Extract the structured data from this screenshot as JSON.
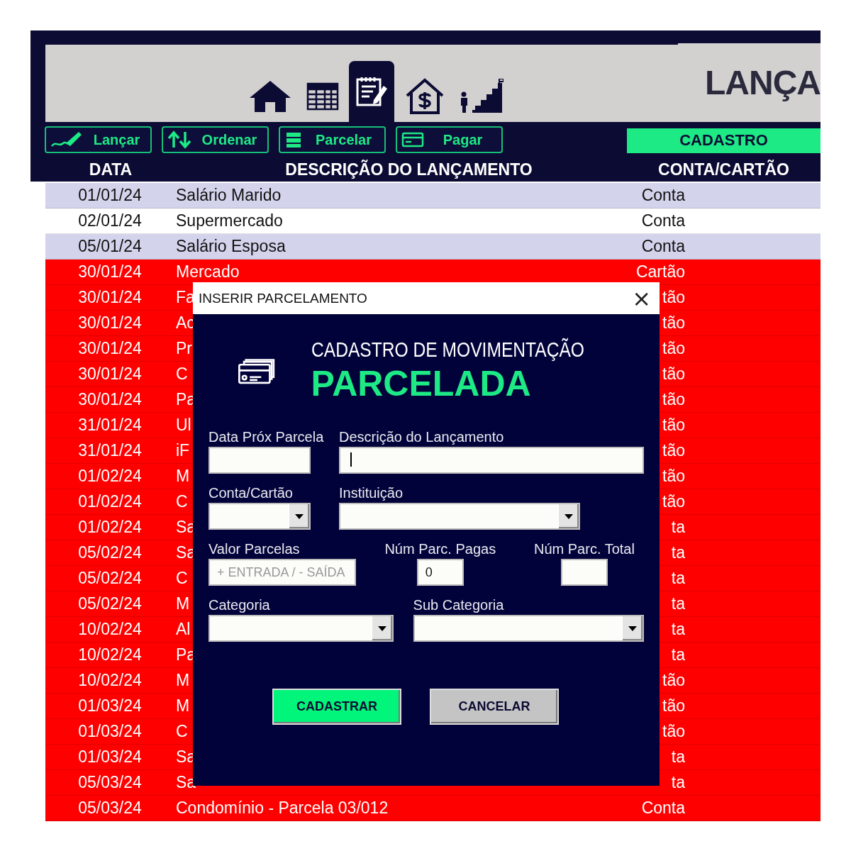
{
  "nav_tabs": [
    {
      "selected": false
    },
    {
      "selected": false
    },
    {
      "selected": true
    },
    {
      "selected": false
    },
    {
      "selected": false
    }
  ],
  "title": "LANÇA",
  "action_buttons": [
    "Lançar",
    "Ordenar",
    "Parcelar",
    "Pagar"
  ],
  "section_label": "CADASTRO",
  "table": {
    "columns": [
      "DATA",
      "DESCRIÇÃO DO LANÇAMENTO",
      "CONTA/CARTÃO"
    ],
    "rows": [
      {
        "date": "01/01/24",
        "description": "Salário Marido",
        "account": "Conta",
        "color": "#d3d3ec"
      },
      {
        "date": "02/01/24",
        "description": "Supermercado",
        "account": "Conta",
        "color": "#ffffff"
      },
      {
        "date": "05/01/24",
        "description": "Salário Esposa",
        "account": "Conta",
        "color": "#d3d3ec"
      },
      {
        "date": "30/01/24",
        "description": "Mercado",
        "account": "Cartão",
        "color": "#ff0000"
      },
      {
        "date": "30/01/24",
        "description": "Fa",
        "account": "tão",
        "color": "#ff0000"
      },
      {
        "date": "30/01/24",
        "description": "Ac",
        "account": "tão",
        "color": "#ff0000"
      },
      {
        "date": "30/01/24",
        "description": "Pr",
        "account": "tão",
        "color": "#ff0000"
      },
      {
        "date": "30/01/24",
        "description": "C",
        "account": "tão",
        "color": "#ff0000"
      },
      {
        "date": "30/01/24",
        "description": "Pa",
        "account": "tão",
        "color": "#ff0000"
      },
      {
        "date": "31/01/24",
        "description": "Ul",
        "account": "tão",
        "color": "#ff0000"
      },
      {
        "date": "31/01/24",
        "description": "iF",
        "account": "tão",
        "color": "#ff0000"
      },
      {
        "date": "01/02/24",
        "description": "M",
        "account": "tão",
        "color": "#ff0000"
      },
      {
        "date": "01/02/24",
        "description": "C",
        "account": "tão",
        "color": "#ff0000"
      },
      {
        "date": "01/02/24",
        "description": "Sa",
        "account": "ta",
        "color": "#ff0000"
      },
      {
        "date": "05/02/24",
        "description": "Sa",
        "account": "ta",
        "color": "#ff0000"
      },
      {
        "date": "05/02/24",
        "description": "C",
        "account": "ta",
        "color": "#ff0000"
      },
      {
        "date": "05/02/24",
        "description": "M",
        "account": "ta",
        "color": "#ff0000"
      },
      {
        "date": "10/02/24",
        "description": "Al",
        "account": "ta",
        "color": "#ff0000"
      },
      {
        "date": "10/02/24",
        "description": "Pa",
        "account": "ta",
        "color": "#ff0000"
      },
      {
        "date": "10/02/24",
        "description": "M",
        "account": "tão",
        "color": "#ff0000"
      },
      {
        "date": "01/03/24",
        "description": "M",
        "account": "tão",
        "color": "#ff0000"
      },
      {
        "date": "01/03/24",
        "description": "C",
        "account": "tão",
        "color": "#ff0000"
      },
      {
        "date": "01/03/24",
        "description": "Sa",
        "account": "ta",
        "color": "#ff0000"
      },
      {
        "date": "05/03/24",
        "description": "Sa",
        "account": "ta",
        "color": "#ff0000"
      },
      {
        "date": "05/03/24",
        "description": "Condomínio - Parcela 03/012",
        "account": "Conta",
        "color": "#ff0000"
      }
    ]
  },
  "dialog": {
    "title": "INSERIR PARCELAMENTO",
    "close": "×",
    "heading": "CADASTRO DE MOVIMENTAÇÃO",
    "subheading": "PARCELADA",
    "fields": [
      {
        "label": "Data Próx Parcela",
        "kind": "text"
      },
      {
        "label": "Descrição do Lançamento",
        "kind": "text",
        "focused": true
      },
      {
        "label": "Conta/Cartão",
        "kind": "dropdown"
      },
      {
        "label": "Instituição",
        "kind": "dropdown"
      },
      {
        "label": "Valor Parcelas",
        "kind": "text",
        "placeholder": "+ ENTRADA / - SAÍDA"
      },
      {
        "label": "Núm Parc. Pagas",
        "kind": "text",
        "value": "0"
      },
      {
        "label": "Núm Parc. Total",
        "kind": "text"
      },
      {
        "label": "Categoria",
        "kind": "dropdown"
      },
      {
        "label": "Sub Categoria",
        "kind": "dropdown"
      }
    ],
    "buttons": [
      {
        "label": "CADASTRAR",
        "kind": "primary"
      },
      {
        "label": "CANCELAR",
        "kind": "secondary"
      }
    ]
  }
}
